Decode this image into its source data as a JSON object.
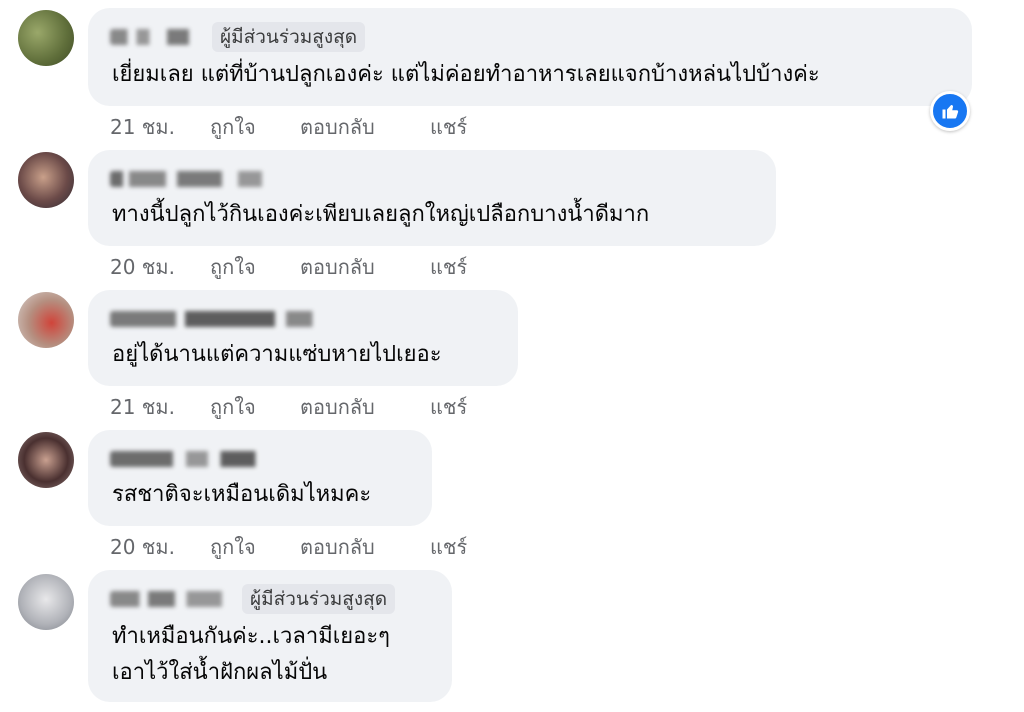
{
  "comments": [
    {
      "badge": "ผู้มีส่วนร่วมสูงสุด",
      "lines": [
        "เยี่ยมเลย แต่ที่บ้านปลูกเองค่ะ แต่ไม่ค่อยทำอาหารเลยแจกบ้างหล่นไปบ้างค่ะ"
      ],
      "time": "21 ชม.",
      "like": "ถูกใจ",
      "reply": "ตอบกลับ",
      "share": "แชร์",
      "reaction_icon": "like-icon"
    },
    {
      "lines": [
        "ทางนี้ปลูกไว้กินเองค่ะเพียบเลยลูกใหญ่เปลือกบางน้ำดีมาก"
      ],
      "time": "20 ชม.",
      "like": "ถูกใจ",
      "reply": "ตอบกลับ",
      "share": "แชร์"
    },
    {
      "lines": [
        "อยู่ได้นานแต่ความแซ่บหายไปเยอะ"
      ],
      "time": "21 ชม.",
      "like": "ถูกใจ",
      "reply": "ตอบกลับ",
      "share": "แชร์"
    },
    {
      "lines": [
        "รสชาติจะเหมือนเดิมไหมคะ"
      ],
      "time": "20 ชม.",
      "like": "ถูกใจ",
      "reply": "ตอบกลับ",
      "share": "แชร์"
    },
    {
      "badge": "ผู้มีส่วนร่วมสูงสุด",
      "lines": [
        "ทำเหมือนกันค่ะ..เวลามีเยอะๆ",
        "เอาไว้ใส่น้ำฝักผลไม้ปั่น"
      ]
    }
  ],
  "colors": {
    "bubble": "#f0f2f5",
    "meta": "#65676b",
    "like_blue": "#1877f2"
  }
}
